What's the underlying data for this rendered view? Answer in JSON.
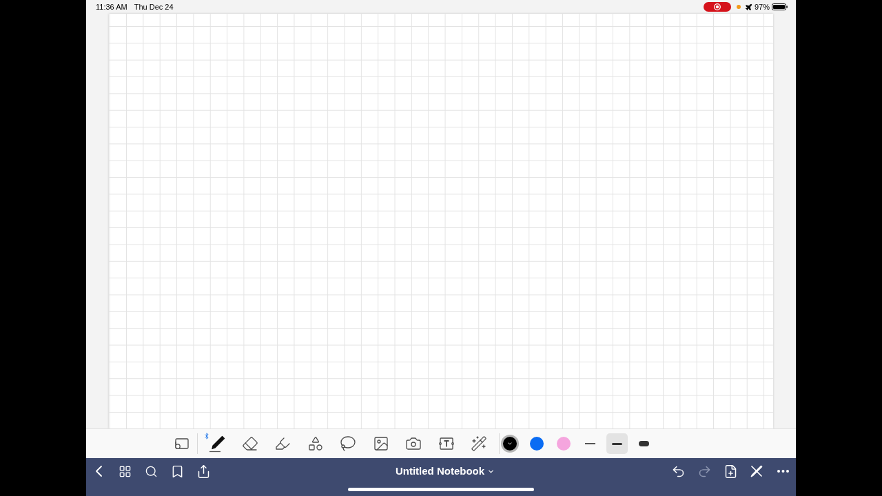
{
  "status_bar": {
    "time": "11:36 AM",
    "date": "Thu Dec 24",
    "screen_recording": true,
    "microphone_in_use": true,
    "airplane_mode": true,
    "battery": "97%"
  },
  "toolbar": {
    "stylus_connected": true,
    "tools": [
      {
        "kind": "read_only",
        "selected": false
      },
      {
        "kind": "pen",
        "selected": true
      },
      {
        "kind": "eraser",
        "selected": false
      },
      {
        "kind": "highlighter",
        "selected": false
      },
      {
        "kind": "shapes",
        "selected": false
      },
      {
        "kind": "lasso",
        "selected": false
      },
      {
        "kind": "image",
        "selected": false
      },
      {
        "kind": "camera",
        "selected": false
      },
      {
        "kind": "text",
        "selected": false
      },
      {
        "kind": "laser_pointer",
        "selected": false
      }
    ],
    "colors": [
      {
        "color": "#000000",
        "selected": true
      },
      {
        "color": "#0a6cf3",
        "selected": false
      },
      {
        "color": "#f5a5de",
        "selected": false
      }
    ],
    "stroke_widths": [
      {
        "kind": "thin",
        "selected": false
      },
      {
        "kind": "medium",
        "selected": true
      },
      {
        "kind": "thick",
        "selected": false
      }
    ]
  },
  "bottom_bar": {
    "title": "Untitled Notebook",
    "undo": {
      "disabled": false
    },
    "redo": {
      "disabled": true
    }
  }
}
